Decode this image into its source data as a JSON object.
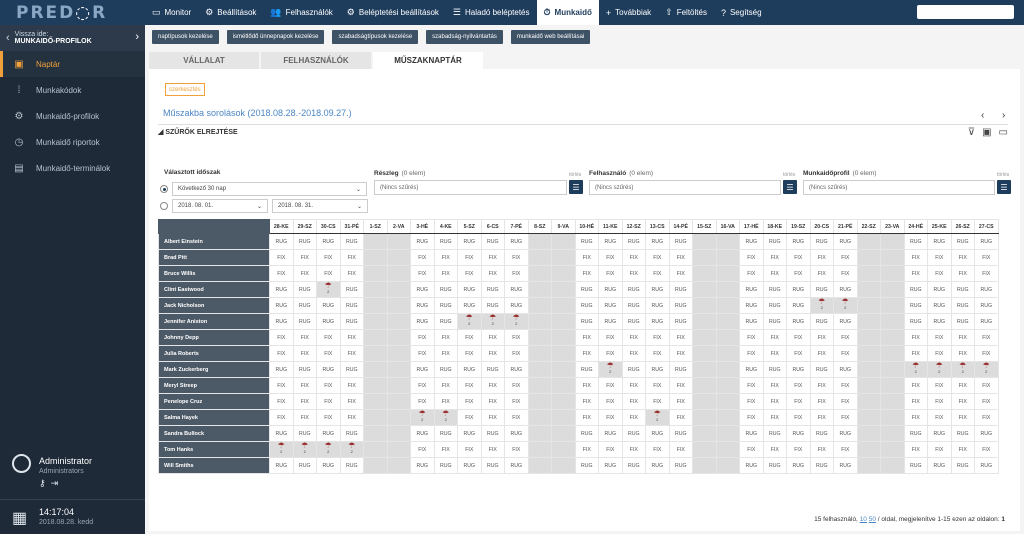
{
  "brand": {
    "logo_left": "PRED",
    "logo_right": "R"
  },
  "topnav": [
    {
      "label": "Monitor",
      "icon": "monitor-icon",
      "glyph": "▭"
    },
    {
      "label": "Beállítások",
      "icon": "gear-icon",
      "glyph": "⚙"
    },
    {
      "label": "Felhasználók",
      "icon": "users-icon",
      "glyph": "👥"
    },
    {
      "label": "Beléptetési beállítások",
      "icon": "door-settings-icon",
      "glyph": "⚙"
    },
    {
      "label": "Haladó beléptetés",
      "icon": "sliders-icon",
      "glyph": "☰"
    },
    {
      "label": "Munkaidő",
      "icon": "worktime-icon",
      "glyph": "⏱",
      "active": true
    },
    {
      "label": "Továbbiak",
      "icon": "plus-icon",
      "glyph": "+"
    },
    {
      "label": "Feltöltés",
      "icon": "upload-icon",
      "glyph": "⇧"
    },
    {
      "label": "Segítség",
      "icon": "help-icon",
      "glyph": "?"
    }
  ],
  "sidebar": {
    "back_label": "Vissza ide:",
    "back_target": "MUNKAIDŐ-PROFILOK",
    "items": [
      {
        "label": "Naptár",
        "icon": "calendar-icon",
        "glyph": "▣",
        "active": true
      },
      {
        "label": "Munkakódok",
        "icon": "grid-dots-icon",
        "glyph": "⁞"
      },
      {
        "label": "Munkaidő-profilok",
        "icon": "profile-icon",
        "glyph": "⚙"
      },
      {
        "label": "Munkaidő riportok",
        "icon": "clock-icon",
        "glyph": "◷"
      },
      {
        "label": "Munkaidő-terminálok",
        "icon": "terminal-icon",
        "glyph": "▤"
      }
    ],
    "user": {
      "name": "Administrator",
      "role": "Administrators"
    },
    "time": "14:17:04",
    "date": "2018.08.28. kedd"
  },
  "subbar": [
    "naptípusok kezelése",
    "ismétlődő ünnepnapok kezelése",
    "szabadságtípusok kezelése",
    "szabadság-nyilvántartás",
    "munkaidő web beállításai"
  ],
  "tabs": [
    {
      "label": "VÁLLALAT"
    },
    {
      "label": "FELHASZNÁLÓK"
    },
    {
      "label": "MŰSZAKNAPTÁR",
      "active": true
    }
  ],
  "edit_label": "szerkesztés",
  "view_title": "Műszakba sorolások (2018.08.28.-2018.09.27.)",
  "filters_toggle": "SZŰRŐK ELREJTÉSE",
  "period": {
    "label": "Választott időszak",
    "option_label": "Következő 30 nap",
    "from": "2018. 08. 01.",
    "to": "2018. 08. 31."
  },
  "filters": [
    {
      "label": "Részleg",
      "count": "(0 elem)",
      "value": "(Nincs szűrés)",
      "clear": "törlés"
    },
    {
      "label": "Felhasználó",
      "count": "(0 elem)",
      "value": "(Nincs szűrés)",
      "clear": "törlés"
    },
    {
      "label": "Munkaidőprofil",
      "count": "(0 elem)",
      "value": "(Nincs szűrés)",
      "clear": "törlés"
    }
  ],
  "days": [
    "28-KE",
    "29-SZ",
    "30-CS",
    "31-PÉ",
    "1-SZ",
    "2-VA",
    "3-HÉ",
    "4-KE",
    "5-SZ",
    "6-CS",
    "7-PÉ",
    "8-SZ",
    "9-VA",
    "10-HÉ",
    "11-KE",
    "12-SZ",
    "13-CS",
    "14-PÉ",
    "15-SZ",
    "16-VA",
    "17-HÉ",
    "18-KE",
    "19-SZ",
    "20-CS",
    "21-PÉ",
    "22-SZ",
    "23-VA",
    "24-HÉ",
    "25-KE",
    "26-SZ",
    "27-CS"
  ],
  "weekend_idx": [
    4,
    5,
    11,
    12,
    18,
    19,
    25,
    26
  ],
  "employees": [
    {
      "name": "Albert Einstein",
      "code": "RUG",
      "sick": []
    },
    {
      "name": "Brad Pitt",
      "code": "FIX",
      "sick": []
    },
    {
      "name": "Bruce Willis",
      "code": "FIX",
      "sick": []
    },
    {
      "name": "Clint Eastwood",
      "code": "RUG",
      "sick": [
        2
      ]
    },
    {
      "name": "Jack  Nicholson",
      "code": "RUG",
      "sick": [
        23,
        24
      ]
    },
    {
      "name": "Jennifer Aniston",
      "code": "RUG",
      "sick": [
        8,
        9,
        10
      ]
    },
    {
      "name": "Johnny Depp",
      "code": "FIX",
      "sick": []
    },
    {
      "name": "Julia Roberts",
      "code": "FIX",
      "sick": []
    },
    {
      "name": "Mark Zuckerberg",
      "code": "RUG",
      "sick": [
        14,
        27,
        28,
        29,
        30
      ]
    },
    {
      "name": "Meryl Streep",
      "code": "FIX",
      "sick": []
    },
    {
      "name": "Penelope Cruz",
      "code": "FIX",
      "sick": []
    },
    {
      "name": "Salma Hayek",
      "code": "FIX",
      "sick": [
        6,
        7,
        16
      ]
    },
    {
      "name": "Sandra Bullock",
      "code": "RUG",
      "sick": []
    },
    {
      "name": "Tom Hanks",
      "code": "FIX",
      "sick": [
        0,
        1,
        2,
        3
      ]
    },
    {
      "name": "Will Smiths",
      "code": "RUG",
      "sick": []
    }
  ],
  "footer": {
    "prefix": "15  felhasználó,",
    "pp1": "10",
    "pp2": "50",
    "suffix": "/ oldal, megjelenítve 1-15 ezen az oldalon:",
    "page": "1"
  }
}
